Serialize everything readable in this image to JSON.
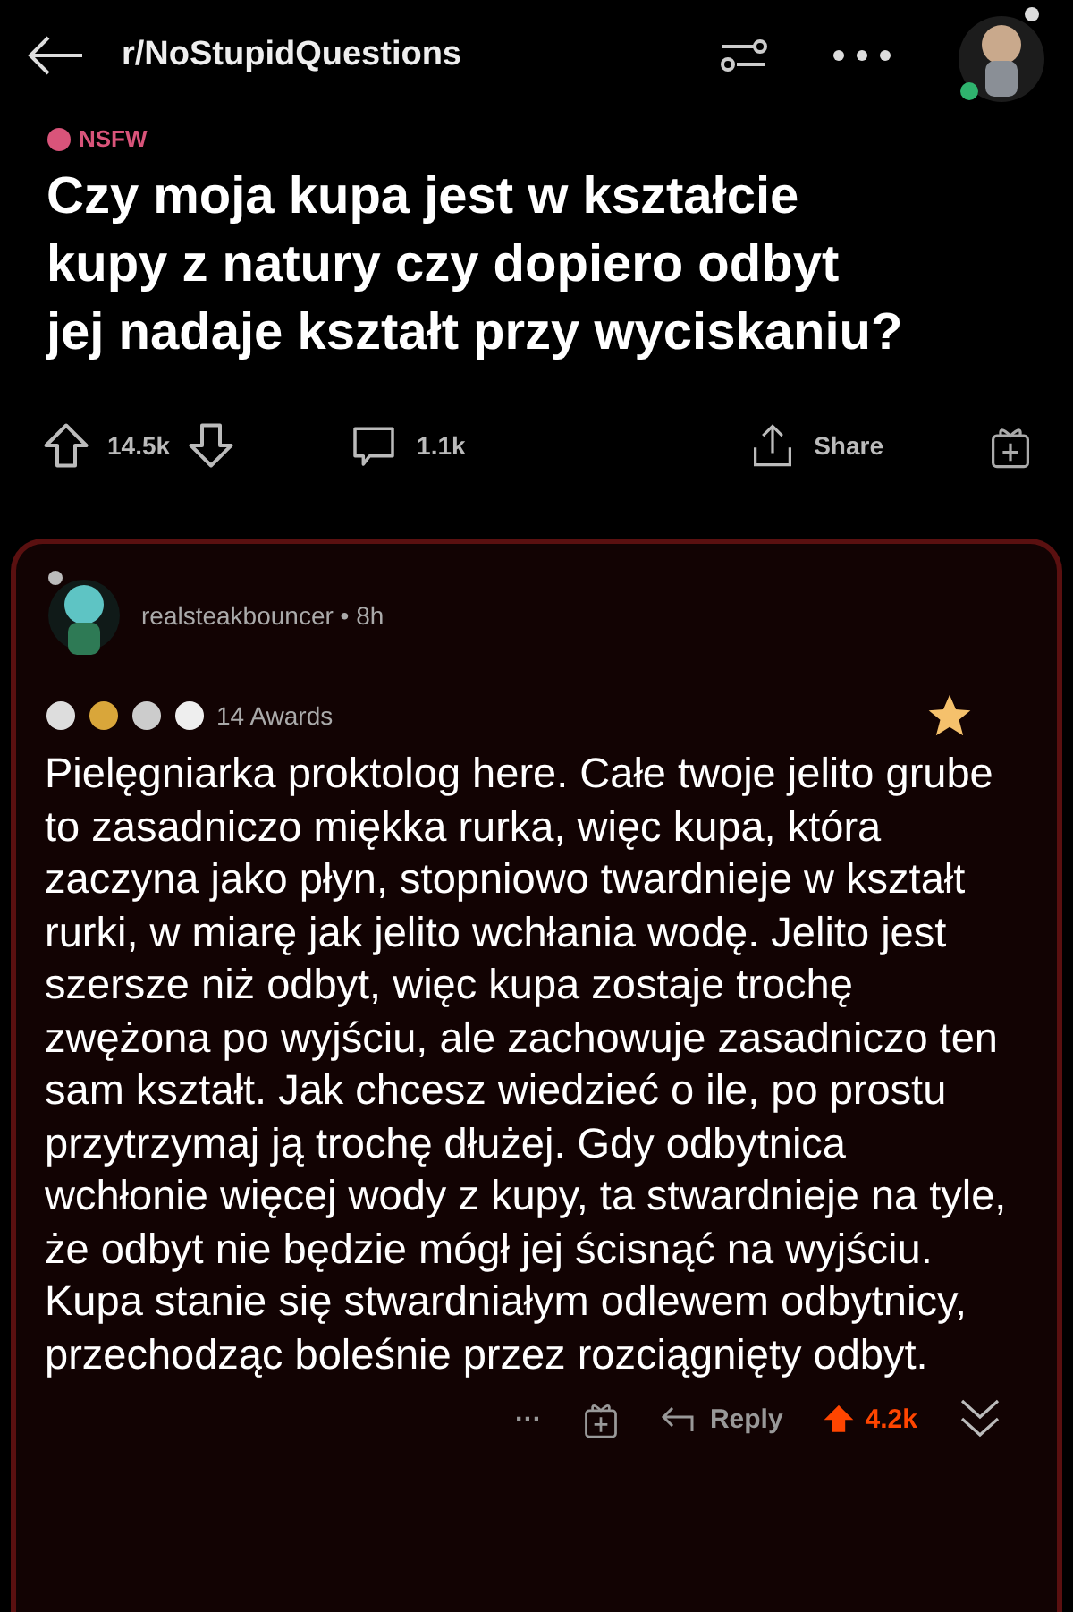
{
  "header": {
    "subreddit": "r/NoStupidQuestions"
  },
  "post": {
    "nsfw_label": "NSFW",
    "title": "Czy moja kupa jest w kształcie kupy z natury czy dopiero odbyt jej nadaje kształt przy wyciskaniu?",
    "votes": "14.5k",
    "comments": "1.1k",
    "share": "Share"
  },
  "comment": {
    "author": "realsteakbouncer",
    "separator": "•",
    "age": "8h",
    "awards": "14 Awards",
    "body": "Pielęgniarka proktolog here. Całe twoje jelito grube to zasadniczo miękka rurka, więc kupa, która zaczyna jako płyn, stopniowo twardnieje w kształt rurki, w miarę jak jelito wchłania wodę. Jelito jest szersze niż odbyt, więc kupa zostaje trochę zwężona po wyjściu, ale zachowuje zasadniczo ten sam kształt. Jak chcesz wiedzieć o ile, po prostu przytrzymaj ją trochę dłużej. Gdy odbytnica wchłonie więcej wody z kupy, ta stwardnieje na tyle, że odbyt nie będzie mógł jej ścisnąć na wyjściu. Kupa stanie się stwardniałym odlewem odbytnicy, przechodząc boleśnie przez rozciągnięty odbyt.",
    "more": "···",
    "reply": "Reply",
    "votes": "4.2k",
    "upvoted": true
  }
}
